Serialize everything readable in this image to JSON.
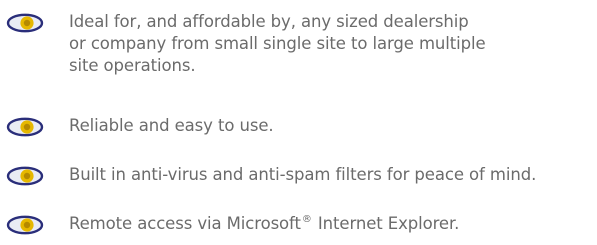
{
  "features": {
    "items": [
      {
        "icon": "eye-bullet-icon",
        "lines": [
          "Ideal for, and affordable by, any sized dealership",
          "or company from small single site to large multiple",
          "site operations."
        ]
      },
      {
        "icon": "eye-bullet-icon",
        "lines": [
          "Reliable and easy to use."
        ]
      },
      {
        "icon": "eye-bullet-icon",
        "lines": [
          "Built in anti-virus and anti-spam filters for peace of mind."
        ]
      },
      {
        "icon": "eye-bullet-icon",
        "before": "Remote access via Microsoft",
        "mark": "®",
        "after": " Internet Explorer."
      }
    ]
  },
  "colors": {
    "text": "#6b6b6b",
    "bullet_outer": "#2a2e7a",
    "bullet_inner": "#e6b800"
  }
}
